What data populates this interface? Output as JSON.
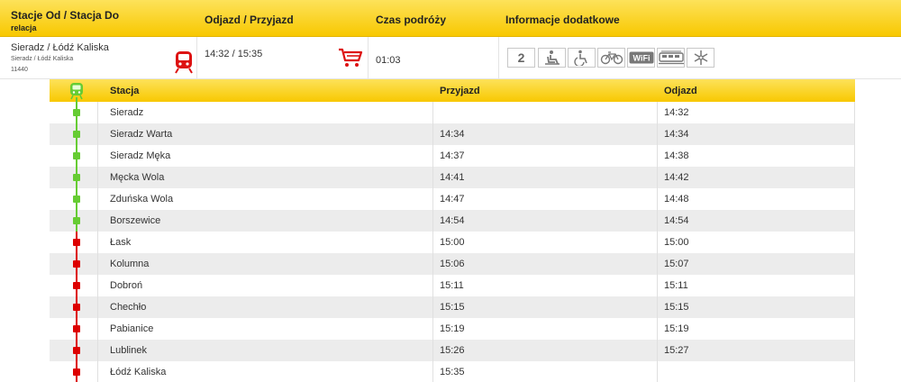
{
  "header": {
    "col_stations": "Stacje Od / Stacja Do",
    "col_stations_sub": "relacja",
    "col_times": "Odjazd / Przyjazd",
    "col_duration": "Czas podróży",
    "col_info": "Informacje dodatkowe"
  },
  "route": {
    "name": "Sieradz / Łódź Kaliska",
    "relation": "Sieradz / Łódź Kaliska",
    "number": "11440",
    "times": "14:32 / 15:35",
    "duration": "01:03",
    "features": [
      {
        "icon": "second-class-icon",
        "text": "2"
      },
      {
        "icon": "seat-icon"
      },
      {
        "icon": "wheelchair-icon"
      },
      {
        "icon": "bicycle-icon"
      },
      {
        "icon": "wifi-icon",
        "text": "WiFi"
      },
      {
        "icon": "train-car-icon"
      },
      {
        "icon": "air-conditioning-icon"
      }
    ]
  },
  "colors": {
    "passed": "#66cc33",
    "upcoming": "#dd0000",
    "header": "#f8c800"
  },
  "stops_header": {
    "station": "Stacja",
    "arrival": "Przyjazd",
    "departure": "Odjazd"
  },
  "stops": [
    {
      "station": "Sieradz",
      "arrival": "",
      "departure": "14:32",
      "status": "passed"
    },
    {
      "station": "Sieradz Warta",
      "arrival": "14:34",
      "departure": "14:34",
      "status": "passed"
    },
    {
      "station": "Sieradz Męka",
      "arrival": "14:37",
      "departure": "14:38",
      "status": "passed"
    },
    {
      "station": "Męcka Wola",
      "arrival": "14:41",
      "departure": "14:42",
      "status": "passed"
    },
    {
      "station": "Zduńska Wola",
      "arrival": "14:47",
      "departure": "14:48",
      "status": "passed"
    },
    {
      "station": "Borszewice",
      "arrival": "14:54",
      "departure": "14:54",
      "status": "passed"
    },
    {
      "station": "Łask",
      "arrival": "15:00",
      "departure": "15:00",
      "status": "upcoming"
    },
    {
      "station": "Kolumna",
      "arrival": "15:06",
      "departure": "15:07",
      "status": "upcoming"
    },
    {
      "station": "Dobroń",
      "arrival": "15:11",
      "departure": "15:11",
      "status": "upcoming"
    },
    {
      "station": "Chechło",
      "arrival": "15:15",
      "departure": "15:15",
      "status": "upcoming"
    },
    {
      "station": "Pabianice",
      "arrival": "15:19",
      "departure": "15:19",
      "status": "upcoming"
    },
    {
      "station": "Lublinek",
      "arrival": "15:26",
      "departure": "15:27",
      "status": "upcoming"
    },
    {
      "station": "Łódź Kaliska",
      "arrival": "15:35",
      "departure": "",
      "status": "upcoming"
    }
  ]
}
